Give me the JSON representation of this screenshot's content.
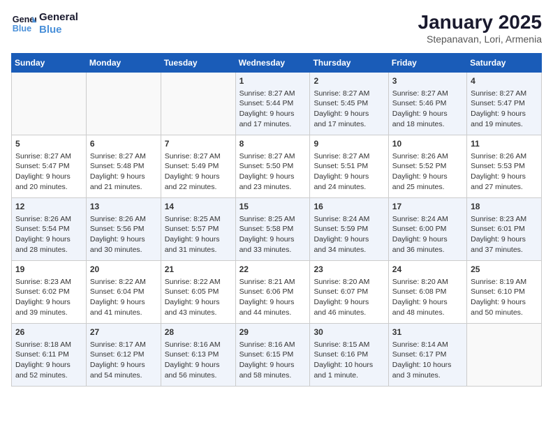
{
  "header": {
    "logo_line1": "General",
    "logo_line2": "Blue",
    "month": "January 2025",
    "location": "Stepanavan, Lori, Armenia"
  },
  "days_of_week": [
    "Sunday",
    "Monday",
    "Tuesday",
    "Wednesday",
    "Thursday",
    "Friday",
    "Saturday"
  ],
  "weeks": [
    [
      {
        "day": "",
        "content": ""
      },
      {
        "day": "",
        "content": ""
      },
      {
        "day": "",
        "content": ""
      },
      {
        "day": "1",
        "content": "Sunrise: 8:27 AM\nSunset: 5:44 PM\nDaylight: 9 hours\nand 17 minutes."
      },
      {
        "day": "2",
        "content": "Sunrise: 8:27 AM\nSunset: 5:45 PM\nDaylight: 9 hours\nand 17 minutes."
      },
      {
        "day": "3",
        "content": "Sunrise: 8:27 AM\nSunset: 5:46 PM\nDaylight: 9 hours\nand 18 minutes."
      },
      {
        "day": "4",
        "content": "Sunrise: 8:27 AM\nSunset: 5:47 PM\nDaylight: 9 hours\nand 19 minutes."
      }
    ],
    [
      {
        "day": "5",
        "content": "Sunrise: 8:27 AM\nSunset: 5:47 PM\nDaylight: 9 hours\nand 20 minutes."
      },
      {
        "day": "6",
        "content": "Sunrise: 8:27 AM\nSunset: 5:48 PM\nDaylight: 9 hours\nand 21 minutes."
      },
      {
        "day": "7",
        "content": "Sunrise: 8:27 AM\nSunset: 5:49 PM\nDaylight: 9 hours\nand 22 minutes."
      },
      {
        "day": "8",
        "content": "Sunrise: 8:27 AM\nSunset: 5:50 PM\nDaylight: 9 hours\nand 23 minutes."
      },
      {
        "day": "9",
        "content": "Sunrise: 8:27 AM\nSunset: 5:51 PM\nDaylight: 9 hours\nand 24 minutes."
      },
      {
        "day": "10",
        "content": "Sunrise: 8:26 AM\nSunset: 5:52 PM\nDaylight: 9 hours\nand 25 minutes."
      },
      {
        "day": "11",
        "content": "Sunrise: 8:26 AM\nSunset: 5:53 PM\nDaylight: 9 hours\nand 27 minutes."
      }
    ],
    [
      {
        "day": "12",
        "content": "Sunrise: 8:26 AM\nSunset: 5:54 PM\nDaylight: 9 hours\nand 28 minutes."
      },
      {
        "day": "13",
        "content": "Sunrise: 8:26 AM\nSunset: 5:56 PM\nDaylight: 9 hours\nand 30 minutes."
      },
      {
        "day": "14",
        "content": "Sunrise: 8:25 AM\nSunset: 5:57 PM\nDaylight: 9 hours\nand 31 minutes."
      },
      {
        "day": "15",
        "content": "Sunrise: 8:25 AM\nSunset: 5:58 PM\nDaylight: 9 hours\nand 33 minutes."
      },
      {
        "day": "16",
        "content": "Sunrise: 8:24 AM\nSunset: 5:59 PM\nDaylight: 9 hours\nand 34 minutes."
      },
      {
        "day": "17",
        "content": "Sunrise: 8:24 AM\nSunset: 6:00 PM\nDaylight: 9 hours\nand 36 minutes."
      },
      {
        "day": "18",
        "content": "Sunrise: 8:23 AM\nSunset: 6:01 PM\nDaylight: 9 hours\nand 37 minutes."
      }
    ],
    [
      {
        "day": "19",
        "content": "Sunrise: 8:23 AM\nSunset: 6:02 PM\nDaylight: 9 hours\nand 39 minutes."
      },
      {
        "day": "20",
        "content": "Sunrise: 8:22 AM\nSunset: 6:04 PM\nDaylight: 9 hours\nand 41 minutes."
      },
      {
        "day": "21",
        "content": "Sunrise: 8:22 AM\nSunset: 6:05 PM\nDaylight: 9 hours\nand 43 minutes."
      },
      {
        "day": "22",
        "content": "Sunrise: 8:21 AM\nSunset: 6:06 PM\nDaylight: 9 hours\nand 44 minutes."
      },
      {
        "day": "23",
        "content": "Sunrise: 8:20 AM\nSunset: 6:07 PM\nDaylight: 9 hours\nand 46 minutes."
      },
      {
        "day": "24",
        "content": "Sunrise: 8:20 AM\nSunset: 6:08 PM\nDaylight: 9 hours\nand 48 minutes."
      },
      {
        "day": "25",
        "content": "Sunrise: 8:19 AM\nSunset: 6:10 PM\nDaylight: 9 hours\nand 50 minutes."
      }
    ],
    [
      {
        "day": "26",
        "content": "Sunrise: 8:18 AM\nSunset: 6:11 PM\nDaylight: 9 hours\nand 52 minutes."
      },
      {
        "day": "27",
        "content": "Sunrise: 8:17 AM\nSunset: 6:12 PM\nDaylight: 9 hours\nand 54 minutes."
      },
      {
        "day": "28",
        "content": "Sunrise: 8:16 AM\nSunset: 6:13 PM\nDaylight: 9 hours\nand 56 minutes."
      },
      {
        "day": "29",
        "content": "Sunrise: 8:16 AM\nSunset: 6:15 PM\nDaylight: 9 hours\nand 58 minutes."
      },
      {
        "day": "30",
        "content": "Sunrise: 8:15 AM\nSunset: 6:16 PM\nDaylight: 10 hours\nand 1 minute."
      },
      {
        "day": "31",
        "content": "Sunrise: 8:14 AM\nSunset: 6:17 PM\nDaylight: 10 hours\nand 3 minutes."
      },
      {
        "day": "",
        "content": ""
      }
    ]
  ]
}
